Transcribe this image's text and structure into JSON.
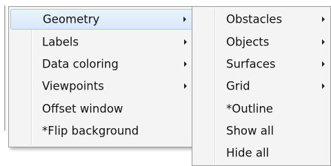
{
  "main_menu": {
    "items": [
      {
        "label": "Geometry",
        "submenu": true,
        "highlighted": true
      },
      {
        "label": "Labels",
        "submenu": true
      },
      {
        "label": "Data coloring",
        "submenu": true
      },
      {
        "label": "Viewpoints",
        "submenu": true
      },
      {
        "label": "Offset window",
        "submenu": false
      },
      {
        "label": "*Flip background",
        "submenu": false
      }
    ]
  },
  "geometry_submenu": {
    "items": [
      {
        "label": "Obstacles",
        "submenu": true
      },
      {
        "label": "Objects",
        "submenu": true
      },
      {
        "label": "Surfaces",
        "submenu": true
      },
      {
        "label": "Grid",
        "submenu": true
      },
      {
        "label": "*Outline",
        "submenu": false
      },
      {
        "label": "Show all",
        "submenu": false
      },
      {
        "label": "Hide all",
        "submenu": false
      }
    ]
  },
  "colors": {
    "highlight_border": "#a8c8ee",
    "highlight_fill": "#d9e8fb",
    "menu_background": "#f4f4f4"
  }
}
